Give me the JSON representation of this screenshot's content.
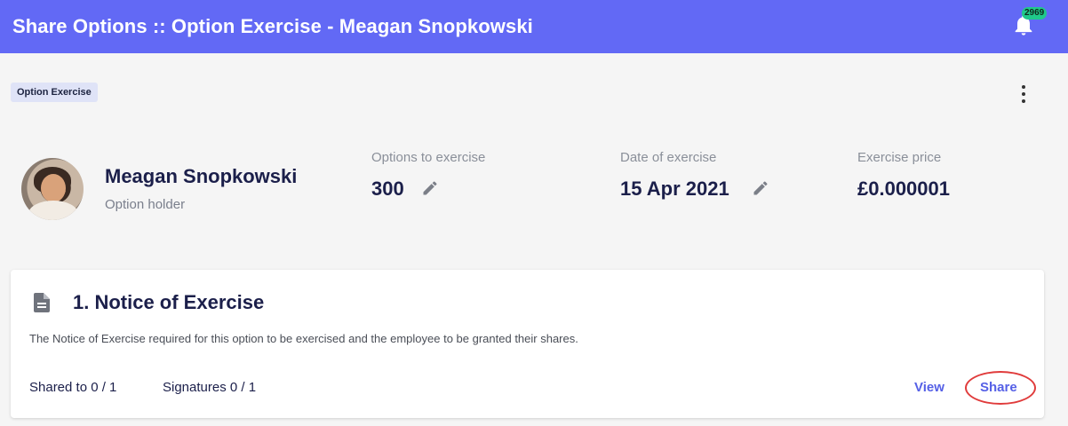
{
  "header": {
    "title": "Share Options :: Option Exercise - Meagan Snopkowski",
    "notification_count": "2969",
    "accent": "#6269f5",
    "badge_color": "#1fc98a"
  },
  "tag": {
    "label": "Option Exercise"
  },
  "menu": {
    "icon": "kebab-menu-icon"
  },
  "holder": {
    "name": "Meagan Snopkowski",
    "role": "Option holder"
  },
  "stats": [
    {
      "label": "Options to exercise",
      "value": "300",
      "editable": true
    },
    {
      "label": "Date of exercise",
      "value": "15 Apr 2021",
      "editable": true
    },
    {
      "label": "Exercise price",
      "value": "£0.000001",
      "editable": false
    }
  ],
  "document": {
    "title": "1. Notice of Exercise",
    "description": "The Notice of Exercise required for this option to be exercised and the employee to be granted their shares.",
    "shared": "Shared to 0 / 1",
    "signatures": "Signatures 0 / 1",
    "view_label": "View",
    "share_label": "Share",
    "highlight_color": "#e03b3b"
  }
}
